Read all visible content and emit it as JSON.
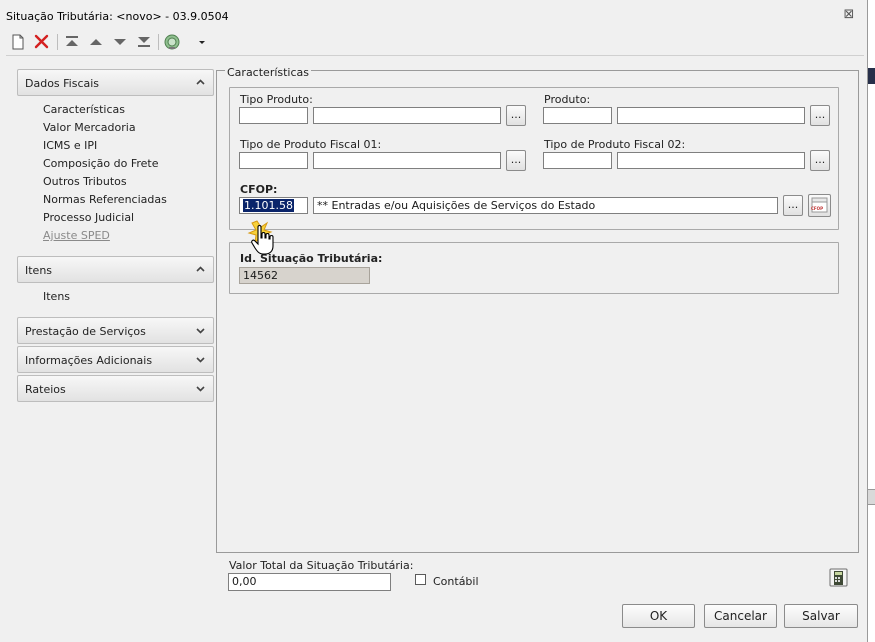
{
  "window": {
    "title": "Situação Tributária: <novo> - 03.9.0504",
    "close_glyph": "⊠"
  },
  "toolbar": {
    "icons": [
      "new-document-icon",
      "delete-icon",
      "first-record-icon",
      "previous-record-icon",
      "next-record-icon",
      "last-record-icon",
      "globe-icon",
      "dropdown-arrow-icon"
    ]
  },
  "sidebar": {
    "sections": [
      {
        "label": "Dados Fiscais",
        "expanded": true,
        "items": [
          "Características",
          "Valor Mercadoria",
          "ICMS e IPI",
          "Composição do Frete",
          "Outros Tributos",
          "Normas Referenciadas",
          "Processo Judicial",
          "Ajuste SPED"
        ]
      },
      {
        "label": "Itens",
        "expanded": true,
        "items": [
          "Itens"
        ]
      },
      {
        "label": "Prestação de Serviços",
        "expanded": false
      },
      {
        "label": "Informações Adicionais",
        "expanded": false
      },
      {
        "label": "Rateios",
        "expanded": false
      }
    ]
  },
  "caracteristicas": {
    "legend": "Características",
    "tipo_produto": {
      "label": "Tipo Produto:",
      "code": "",
      "description": "",
      "lookup": "..."
    },
    "produto": {
      "label": "Produto:",
      "code": "",
      "description": "",
      "lookup": "..."
    },
    "tipo_fiscal_01": {
      "label": "Tipo de Produto Fiscal 01:",
      "code": "",
      "description": "",
      "lookup": "..."
    },
    "tipo_fiscal_02": {
      "label": "Tipo de Produto Fiscal 02:",
      "code": "",
      "description": "",
      "lookup": "..."
    },
    "cfop": {
      "label": "CFOP:",
      "code": "1.101.58",
      "description": "** Entradas e/ou Aquisições de Serviços do Estado",
      "lookup": "...",
      "badge": "CFOP"
    }
  },
  "id_situacao": {
    "label": "Id. Situação Tributária:",
    "value": "14562"
  },
  "footer": {
    "valor_total_label": "Valor Total da Situação Tributária:",
    "valor_total_value": "0,00",
    "contabil_label": "Contábil",
    "contabil_checked": false,
    "ok_label": "OK",
    "cancel_label": "Cancelar",
    "save_label": "Salvar"
  },
  "colors": {
    "selection": "#0a246a",
    "readonly_bg": "#d7d3cd"
  }
}
